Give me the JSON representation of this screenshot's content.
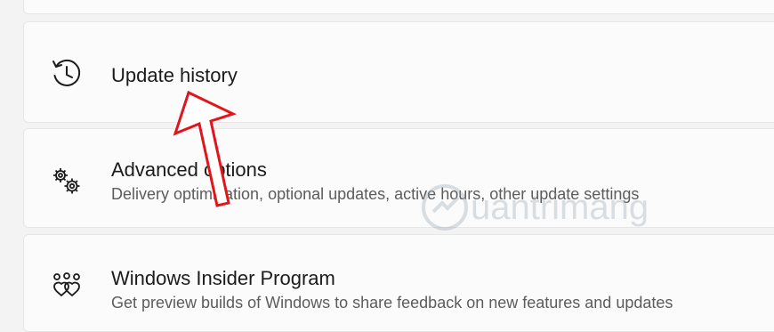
{
  "cards": {
    "update_history": {
      "title": "Update history",
      "icon": "history-icon"
    },
    "advanced_options": {
      "title": "Advanced options",
      "subtitle": "Delivery optimization, optional updates, active hours, other update settings",
      "icon": "gears-icon"
    },
    "insider_program": {
      "title": "Windows Insider Program",
      "subtitle": "Get preview builds of Windows to share feedback on new features and updates",
      "icon": "insider-hearts-icon"
    }
  },
  "annotation": {
    "arrow_color": "#e0161c"
  },
  "watermark": {
    "text": "uantrimang"
  }
}
